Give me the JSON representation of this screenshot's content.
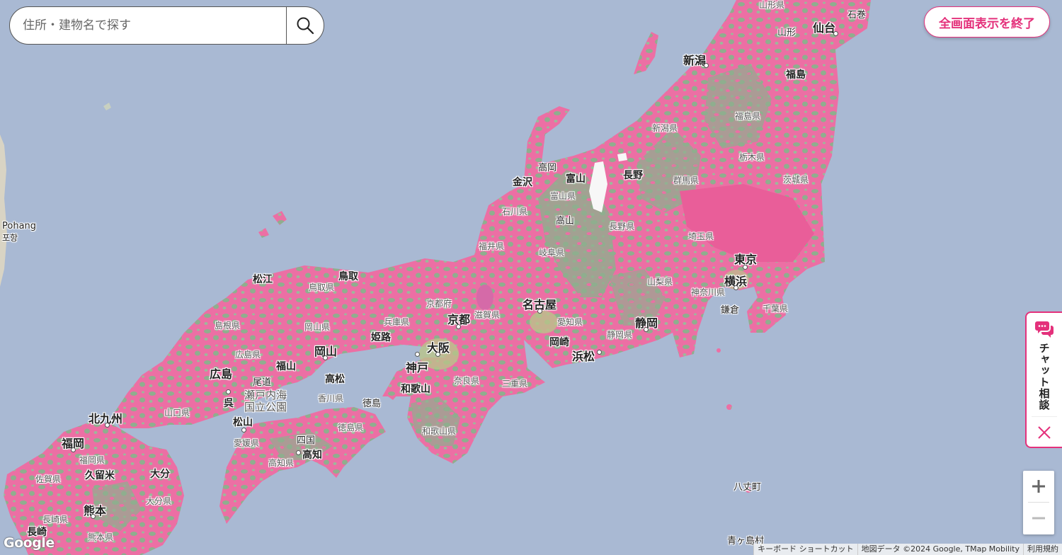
{
  "search": {
    "placeholder": "住所・建物名で探す"
  },
  "exit_fullscreen_label": "全画面表示を終了",
  "chat": {
    "label": "チャット相談"
  },
  "zoom": {
    "in": "+",
    "out": "−"
  },
  "attribution": {
    "shortcuts": "キーボード ショートカット",
    "map_data": "地図データ ©2024 Google, TMap Mobility",
    "terms": "利用規約"
  },
  "google_logo": "Google",
  "colors": {
    "accent": "#e4317b",
    "coverage": "#ec6fa4",
    "water": "#a9b9d3",
    "land": "#8fae8e"
  },
  "labels": {
    "cities": {
      "yamagata_top": "山形県",
      "ishinomaki": "石巻",
      "sendai": "仙台",
      "yamagata": "山形",
      "niigata": "新潟",
      "fukushima": "福島",
      "takaoka": "高岡",
      "toyama": "富山",
      "kanazawa": "金沢",
      "nagano": "長野",
      "takayama": "高山",
      "tokyo": "東京",
      "yokohama": "横浜",
      "kamakura": "鎌倉",
      "matsue": "松江",
      "tottori": "鳥取",
      "kyoto": "京都",
      "nagoya": "名古屋",
      "shizuoka": "静岡",
      "himeji": "姫路",
      "osaka": "大阪",
      "kobe": "神戸",
      "okazaki": "岡崎",
      "hamamatsu": "浜松",
      "okayama": "岡山",
      "fukuyama": "福山",
      "hiroshima": "広島",
      "onomichi": "尾道",
      "takamatsu": "高松",
      "wakayama": "和歌山",
      "kure": "呉",
      "setonaikai": "瀬戸内海",
      "setonaikai2": "国立公園",
      "tokushima": "徳島",
      "kitakyushu": "北九州",
      "matsuyama": "松山",
      "fukuoka": "福岡",
      "shikoku": "四国",
      "kochi": "高知",
      "oita": "大分",
      "kurume": "久留米",
      "kumamoto": "熊本",
      "nagasaki": "長崎",
      "hachijo": "八丈町",
      "aogashima": "青ヶ島村",
      "pohang": "Pohang",
      "pohang_ko": "포항"
    },
    "prefs": {
      "fukushima_ken": "福島県",
      "niigata_ken": "新潟県",
      "tochigi_ken": "栃木県",
      "gunma_ken": "群馬県",
      "ibaraki_ken": "茨城県",
      "toyama_ken": "富山県",
      "ishikawa_ken": "石川県",
      "nagano_ken": "長野県",
      "saitama_ken": "埼玉県",
      "fukui_ken": "福井県",
      "gifu_ken": "岐阜県",
      "yamanashi_ken": "山梨県",
      "kanagawa_ken": "神奈川県",
      "chiba_ken": "千葉県",
      "tottori_ken": "鳥取県",
      "kyoto_fu": "京都府",
      "shimane_ken": "島根県",
      "okayama_ken": "岡山県",
      "hyogo_ken": "兵庫県",
      "shiga_ken": "滋賀県",
      "aichi_ken": "愛知県",
      "shizuoka_ken": "静岡県",
      "hiroshima_ken": "広島県",
      "nara_ken": "奈良県",
      "mie_ken": "三重県",
      "kagawa_ken": "香川県",
      "yamaguchi_ken": "山口県",
      "tokushima_ken": "徳島県",
      "wakayama_ken": "和歌山県",
      "ehime_ken": "愛媛県",
      "fukuoka_ken": "福岡県",
      "saga_ken": "佐賀県",
      "kochi_ken": "高知県",
      "oita_ken": "大分県",
      "nagasaki_ken": "長崎県",
      "kumamoto_ken": "熊本県"
    }
  }
}
